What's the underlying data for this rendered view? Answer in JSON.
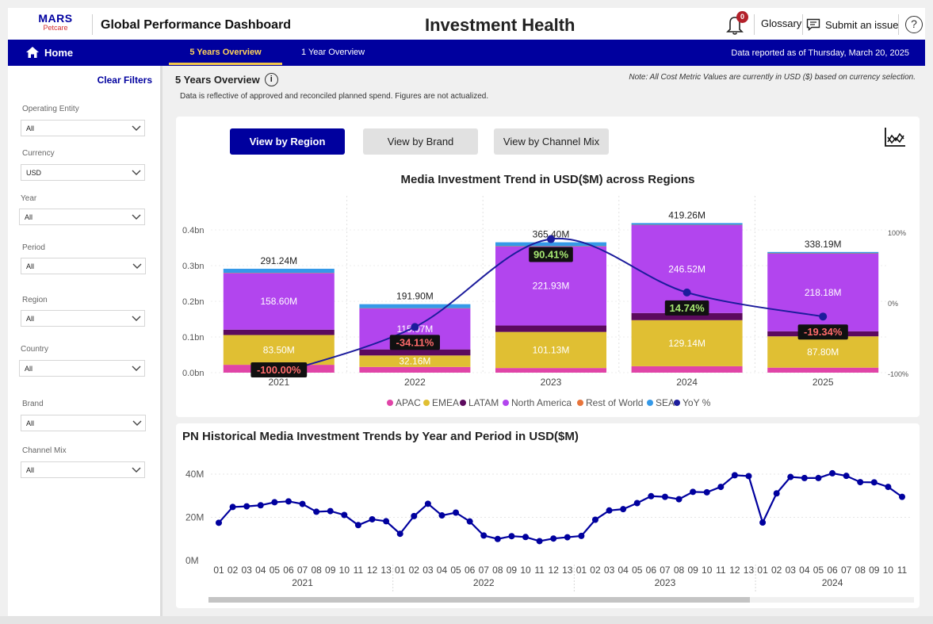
{
  "header": {
    "logo_line1": "MARS",
    "logo_line2": "Petcare",
    "app_title": "Global Performance Dashboard",
    "page_title": "Investment Health",
    "notification_count": "0",
    "glossary": "Glossary",
    "submit_issue": "Submit an issue",
    "help": "?"
  },
  "nav": {
    "home": "Home",
    "tabs": [
      "5 Years Overview",
      "1 Year Overview"
    ],
    "active_tab": "5 Years Overview",
    "reported": "Data reported as of Thursday, March 20, 2025"
  },
  "sidebar": {
    "clear_filters": "Clear Filters",
    "filters": [
      {
        "label": "Operating Entity",
        "value": "All"
      },
      {
        "label": "Currency",
        "value": "USD"
      },
      {
        "label": "Year",
        "value": "All"
      },
      {
        "label": "Period",
        "value": "All"
      },
      {
        "label": "Region",
        "value": "All"
      },
      {
        "label": "Country",
        "value": "All"
      },
      {
        "label": "Brand",
        "value": "All"
      },
      {
        "label": "Channel Mix",
        "value": "All"
      }
    ]
  },
  "content": {
    "overview_title": "5 Years Overview",
    "info_glyph": "i",
    "note": "Note: All Cost Metric Values are currently in USD ($) based on currency selection.",
    "disclaimer": "Data is reflective of approved and reconciled planned spend. Figures are not actualized.",
    "view_buttons": [
      "View by Region",
      "View by Brand",
      "View by Channel Mix"
    ],
    "active_view": "View by Region"
  },
  "colors": {
    "navy": "#00009e",
    "apac": "#e044a7",
    "emea": "#e0bf33",
    "latam": "#5c0a5e",
    "north_america": "#b245ee",
    "rest_of_world": "#e8743b",
    "sea": "#3599e8",
    "yoy_line": "#1c1c9c",
    "trend_line": "#00009e"
  },
  "chart_data": [
    {
      "type": "bar",
      "stacked": true,
      "title": "Media Investment Trend in USD($M) across Regions",
      "categories": [
        "2021",
        "2022",
        "2023",
        "2024",
        "2025"
      ],
      "y_ticks": [
        "0.0bn",
        "0.1bn",
        "0.2bn",
        "0.3bn",
        "0.4bn"
      ],
      "ylim": [
        0,
        440
      ],
      "secondary_y_ticks": [
        "100%",
        "0%",
        "-100%"
      ],
      "secondary_ylim": [
        -100,
        100
      ],
      "series": [
        {
          "name": "APAC",
          "values": [
            22,
            16,
            13,
            18,
            14
          ]
        },
        {
          "name": "EMEA",
          "values": [
            83.5,
            32.16,
            101.13,
            129.14,
            87.8
          ]
        },
        {
          "name": "LATAM",
          "values": [
            15,
            17,
            18,
            20,
            14
          ]
        },
        {
          "name": "North America",
          "values": [
            158.6,
            115.07,
            221.93,
            246.52,
            218.18
          ]
        },
        {
          "name": "Rest of World",
          "values": [
            0.5,
            0.4,
            0.5,
            0.6,
            0.5
          ]
        },
        {
          "name": "SEA",
          "values": [
            11.64,
            11.27,
            10.84,
            5,
            3.71
          ]
        }
      ],
      "segment_labels": {
        "EMEA": [
          "83.50M",
          "32.16M",
          "101.13M",
          "129.14M",
          "87.80M"
        ],
        "North America": [
          "158.60M",
          "115.07M",
          "221.93M",
          "246.52M",
          "218.18M"
        ]
      },
      "totals": [
        "291.24M",
        "191.90M",
        "365.40M",
        "419.26M",
        "338.19M"
      ],
      "yoy": {
        "name": "YoY %",
        "values": [
          -100,
          -34.11,
          90.41,
          14.74,
          -19.34
        ],
        "labels": [
          "-100.00%",
          "-34.11%",
          "90.41%",
          "14.74%",
          "-19.34%"
        ]
      },
      "legend": [
        "APAC",
        "EMEA",
        "LATAM",
        "North America",
        "Rest of World",
        "SEA",
        "YoY %"
      ],
      "legend_position": "bottom"
    },
    {
      "type": "line",
      "title": "PN Historical Media Investment Trends by Year and Period in USD($M)",
      "y_ticks": [
        "0M",
        "20M",
        "40M"
      ],
      "ylim": [
        0,
        40
      ],
      "grid": true,
      "period_labels": [
        "01",
        "02",
        "03",
        "04",
        "05",
        "06",
        "07",
        "08",
        "09",
        "10",
        "11",
        "12",
        "13",
        "01",
        "02",
        "03",
        "04",
        "05",
        "06",
        "07",
        "08",
        "09",
        "10",
        "11",
        "12",
        "13",
        "01",
        "02",
        "03",
        "04",
        "05",
        "06",
        "07",
        "08",
        "09",
        "10",
        "11",
        "12",
        "13",
        "01",
        "02",
        "03",
        "04",
        "05",
        "06",
        "07",
        "08",
        "09",
        "10",
        "11"
      ],
      "year_labels": [
        "2021",
        "2022",
        "2023",
        "2024"
      ],
      "year_period_counts": [
        13,
        13,
        13,
        11
      ],
      "values": [
        17.5,
        24.8,
        25.1,
        25.6,
        27,
        27.4,
        26.2,
        22.6,
        22.9,
        21.1,
        16.4,
        19.1,
        18.2,
        12.4,
        20.6,
        26.3,
        20.9,
        22.2,
        18.1,
        11.6,
        10,
        11.3,
        10.9,
        9,
        10.2,
        10.8,
        11.4,
        18.9,
        23.2,
        23.8,
        26.6,
        29.8,
        29.5,
        28.4,
        31.8,
        31.6,
        34.1,
        39.5,
        39.1,
        17.6,
        31.1,
        38.7,
        38.2,
        38.2,
        40.4,
        39.2,
        36.3,
        36.2,
        34.1,
        29.5
      ]
    }
  ]
}
